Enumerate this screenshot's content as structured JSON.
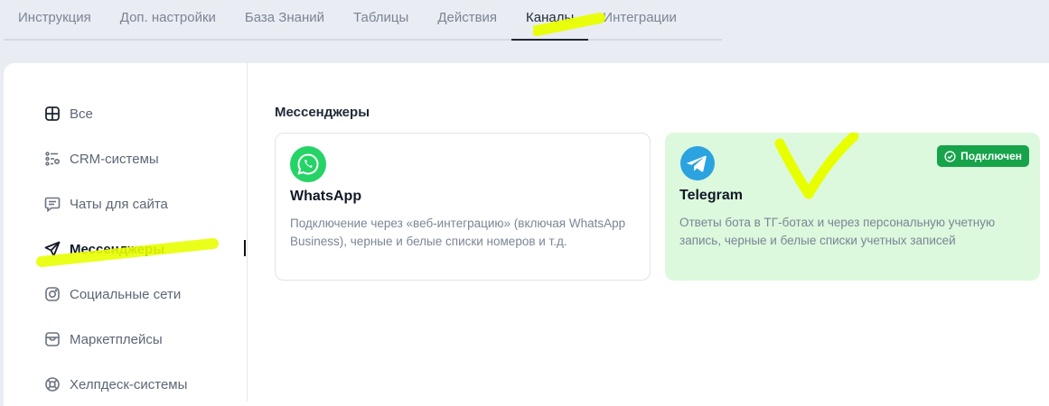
{
  "tabs": [
    {
      "label": "Инструкция",
      "active": false
    },
    {
      "label": "Доп. настройки",
      "active": false
    },
    {
      "label": "База Знаний",
      "active": false
    },
    {
      "label": "Таблицы",
      "active": false
    },
    {
      "label": "Действия",
      "active": false
    },
    {
      "label": "Каналы",
      "active": true
    },
    {
      "label": "Интеграции",
      "active": false
    }
  ],
  "sidebar": {
    "items": [
      {
        "label": "Все",
        "icon": "grid-icon"
      },
      {
        "label": "CRM-системы",
        "icon": "list-settings-icon"
      },
      {
        "label": "Чаты для сайта",
        "icon": "chat-icon"
      },
      {
        "label": "Мессенджеры",
        "icon": "send-icon",
        "active": true
      },
      {
        "label": "Социальные сети",
        "icon": "instagram-icon"
      },
      {
        "label": "Маркетплейсы",
        "icon": "store-icon"
      },
      {
        "label": "Хелпдеск-системы",
        "icon": "lifebuoy-icon"
      }
    ]
  },
  "content": {
    "section_title": "Мессенджеры",
    "cards": [
      {
        "name": "WhatsApp",
        "icon": "whatsapp-icon",
        "description": "Подключение через «веб-интеграцию» (включая WhatsApp Business), черные и белые списки номеров и т.д.",
        "connected": false
      },
      {
        "name": "Telegram",
        "icon": "telegram-icon",
        "description": "Ответы бота в ТГ-ботах и через персональную учетную запись, черные и белые списки учетных записей",
        "connected": true,
        "badge": "Подключен"
      }
    ]
  },
  "colors": {
    "highlight": "#e8ff00",
    "connected_bg": "#dcf8dd",
    "badge_green": "#16a34a",
    "whatsapp_green": "#25d366",
    "telegram_blue": "#2aa3e0"
  }
}
